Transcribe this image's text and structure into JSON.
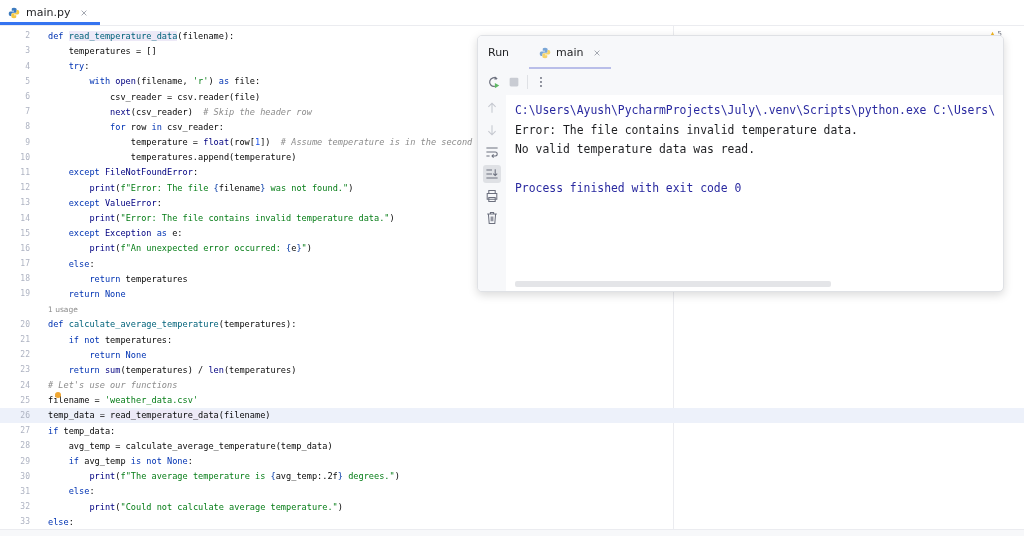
{
  "editor_tabs": [
    {
      "label": "main.py",
      "selected": true
    }
  ],
  "inspection_count": "5",
  "lines": [
    {
      "kind": "code",
      "number": "2",
      "current": false,
      "bulb": false,
      "tokens": [
        {
          "kind": "kw",
          "text": "def "
        },
        {
          "kind": "name_hl",
          "text": "read_temperature_data"
        },
        {
          "kind": "plain",
          "text": "(filename):"
        }
      ],
      "children": [
        {
          "kind": "code",
          "number": "3",
          "current": false,
          "bulb": false,
          "tokens": [
            {
              "kind": "plain",
              "text": "temperatures = []"
            }
          ]
        },
        {
          "kind": "code",
          "number": "4",
          "current": false,
          "bulb": false,
          "tokens": [
            {
              "kind": "kw",
              "text": "try"
            },
            {
              "kind": "plain",
              "text": ":"
            }
          ],
          "children": [
            {
              "kind": "code",
              "number": "5",
              "current": false,
              "bulb": false,
              "tokens": [
                {
                  "kind": "kw",
                  "text": "with "
                },
                {
                  "kind": "builtin",
                  "text": "open"
                },
                {
                  "kind": "plain",
                  "text": "(filename, "
                },
                {
                  "kind": "str",
                  "text": "'r'"
                },
                {
                  "kind": "plain",
                  "text": ") "
                },
                {
                  "kind": "kw",
                  "text": "as"
                },
                {
                  "kind": "plain",
                  "text": " file:"
                }
              ],
              "children": [
                {
                  "kind": "code",
                  "number": "6",
                  "current": false,
                  "bulb": false,
                  "tokens": [
                    {
                      "kind": "plain",
                      "text": "csv_reader = csv.reader(file)"
                    }
                  ]
                },
                {
                  "kind": "code",
                  "number": "7",
                  "current": false,
                  "bulb": false,
                  "tokens": [
                    {
                      "kind": "builtin",
                      "text": "next"
                    },
                    {
                      "kind": "plain",
                      "text": "(csv_reader)  "
                    },
                    {
                      "kind": "cmt",
                      "text": "# Skip the header row"
                    }
                  ]
                },
                {
                  "kind": "code",
                  "number": "8",
                  "current": false,
                  "bulb": false,
                  "tokens": [
                    {
                      "kind": "kw",
                      "text": "for"
                    },
                    {
                      "kind": "plain",
                      "text": " row "
                    },
                    {
                      "kind": "kw",
                      "text": "in"
                    },
                    {
                      "kind": "plain",
                      "text": " csv_reader:"
                    }
                  ],
                  "children": [
                    {
                      "kind": "code",
                      "number": "9",
                      "current": false,
                      "bulb": false,
                      "tokens": [
                        {
                          "kind": "plain",
                          "text": "temperature = "
                        },
                        {
                          "kind": "builtin",
                          "text": "float"
                        },
                        {
                          "kind": "plain",
                          "text": "(row["
                        },
                        {
                          "kind": "num",
                          "text": "1"
                        },
                        {
                          "kind": "plain",
                          "text": "])  "
                        },
                        {
                          "kind": "cmt",
                          "text": "# Assume temperature is in the second"
                        }
                      ]
                    },
                    {
                      "kind": "code",
                      "number": "10",
                      "current": false,
                      "bulb": false,
                      "tokens": [
                        {
                          "kind": "plain",
                          "text": "temperatures.append(temperature)"
                        }
                      ]
                    }
                  ]
                }
              ]
            }
          ]
        },
        {
          "kind": "code",
          "number": "11",
          "current": false,
          "bulb": false,
          "tokens": [
            {
              "kind": "kw",
              "text": "except "
            },
            {
              "kind": "builtin",
              "text": "FileNotFoundError"
            },
            {
              "kind": "plain",
              "text": ":"
            }
          ],
          "children": [
            {
              "kind": "code",
              "number": "12",
              "current": false,
              "bulb": false,
              "tokens": [
                {
                  "kind": "builtin",
                  "text": "print"
                },
                {
                  "kind": "plain",
                  "text": "("
                },
                {
                  "kind": "str",
                  "text": "f\"Error: The file "
                },
                {
                  "kind": "brace",
                  "text": "{"
                },
                {
                  "kind": "plain",
                  "text": "filename"
                },
                {
                  "kind": "brace",
                  "text": "}"
                },
                {
                  "kind": "str",
                  "text": " was not found.\""
                },
                {
                  "kind": "plain",
                  "text": ")"
                }
              ]
            }
          ]
        },
        {
          "kind": "code",
          "number": "13",
          "current": false,
          "bulb": false,
          "tokens": [
            {
              "kind": "kw",
              "text": "except "
            },
            {
              "kind": "builtin",
              "text": "ValueError"
            },
            {
              "kind": "plain",
              "text": ":"
            }
          ],
          "children": [
            {
              "kind": "code",
              "number": "14",
              "current": false,
              "bulb": false,
              "tokens": [
                {
                  "kind": "builtin",
                  "text": "print"
                },
                {
                  "kind": "plain",
                  "text": "("
                },
                {
                  "kind": "str",
                  "text": "\"Error: The file contains invalid temperature data.\""
                },
                {
                  "kind": "plain",
                  "text": ")"
                }
              ]
            }
          ]
        },
        {
          "kind": "code",
          "number": "15",
          "current": false,
          "bulb": false,
          "tokens": [
            {
              "kind": "kw",
              "text": "except "
            },
            {
              "kind": "builtin",
              "text": "Exception"
            },
            {
              "kind": "kw",
              "text": " as"
            },
            {
              "kind": "plain",
              "text": " e:"
            }
          ],
          "children": [
            {
              "kind": "code",
              "number": "16",
              "current": false,
              "bulb": false,
              "tokens": [
                {
                  "kind": "builtin",
                  "text": "print"
                },
                {
                  "kind": "plain",
                  "text": "("
                },
                {
                  "kind": "str",
                  "text": "f\"An unexpected error occurred: "
                },
                {
                  "kind": "brace",
                  "text": "{"
                },
                {
                  "kind": "plain",
                  "text": "e"
                },
                {
                  "kind": "brace",
                  "text": "}"
                },
                {
                  "kind": "str",
                  "text": "\""
                },
                {
                  "kind": "plain",
                  "text": ")"
                }
              ]
            }
          ]
        },
        {
          "kind": "code",
          "number": "17",
          "current": false,
          "bulb": false,
          "tokens": [
            {
              "kind": "kw",
              "text": "else"
            },
            {
              "kind": "plain",
              "text": ":"
            }
          ],
          "children": [
            {
              "kind": "code",
              "number": "18",
              "current": false,
              "bulb": false,
              "tokens": [
                {
                  "kind": "kw",
                  "text": "return"
                },
                {
                  "kind": "plain",
                  "text": " temperatures"
                }
              ]
            }
          ]
        },
        {
          "kind": "code",
          "number": "19",
          "current": false,
          "bulb": false,
          "tokens": [
            {
              "kind": "kw",
              "text": "return None"
            }
          ]
        }
      ]
    },
    {
      "kind": "hint",
      "text": "1 usage"
    },
    {
      "kind": "code",
      "number": "20",
      "current": false,
      "bulb": false,
      "tokens": [
        {
          "kind": "kw",
          "text": "def "
        },
        {
          "kind": "name",
          "text": "calculate_average_temperature"
        },
        {
          "kind": "plain",
          "text": "(temperatures):"
        }
      ],
      "children": [
        {
          "kind": "code",
          "number": "21",
          "current": false,
          "bulb": false,
          "tokens": [
            {
              "kind": "kw",
              "text": "if not"
            },
            {
              "kind": "plain",
              "text": " temperatures:"
            }
          ],
          "children": [
            {
              "kind": "code",
              "number": "22",
              "current": false,
              "bulb": false,
              "tokens": [
                {
                  "kind": "kw",
                  "text": "return None"
                }
              ]
            }
          ]
        },
        {
          "kind": "code",
          "number": "23",
          "current": false,
          "bulb": false,
          "tokens": [
            {
              "kind": "kw",
              "text": "return "
            },
            {
              "kind": "builtin",
              "text": "sum"
            },
            {
              "kind": "plain",
              "text": "(temperatures) / "
            },
            {
              "kind": "builtin",
              "text": "len"
            },
            {
              "kind": "plain",
              "text": "(temperatures)"
            }
          ]
        }
      ]
    },
    {
      "kind": "code",
      "number": "24",
      "current": false,
      "bulb": false,
      "tokens": [
        {
          "kind": "cmt",
          "text": "# Let's use our functions"
        }
      ]
    },
    {
      "kind": "code",
      "number": "25",
      "current": false,
      "bulb": true,
      "tokens": [
        {
          "kind": "plain",
          "text": "filename = "
        },
        {
          "kind": "str",
          "text": "'weather_data.csv'"
        }
      ]
    },
    {
      "kind": "code",
      "number": "26",
      "current": true,
      "bulb": false,
      "tokens": [
        {
          "kind": "plain",
          "text": "temp_data = "
        },
        {
          "kind": "plain_hl",
          "text": "read_temperature_data"
        },
        {
          "kind": "plain",
          "text": "(filename)"
        }
      ]
    },
    {
      "kind": "code",
      "number": "27",
      "current": false,
      "bulb": false,
      "tokens": [
        {
          "kind": "kw",
          "text": "if"
        },
        {
          "kind": "plain",
          "text": " temp_data:"
        }
      ],
      "children": [
        {
          "kind": "code",
          "number": "28",
          "current": false,
          "bulb": false,
          "tokens": [
            {
              "kind": "plain",
              "text": "avg_temp = calculate_average_temperature(temp_data)"
            }
          ]
        },
        {
          "kind": "code",
          "number": "29",
          "current": false,
          "bulb": false,
          "tokens": [
            {
              "kind": "kw",
              "text": "if"
            },
            {
              "kind": "plain",
              "text": " avg_temp "
            },
            {
              "kind": "kw",
              "text": "is not None"
            },
            {
              "kind": "plain",
              "text": ":"
            }
          ],
          "children": [
            {
              "kind": "code",
              "number": "30",
              "current": false,
              "bulb": false,
              "tokens": [
                {
                  "kind": "builtin",
                  "text": "print"
                },
                {
                  "kind": "plain",
                  "text": "("
                },
                {
                  "kind": "str",
                  "text": "f\"The average temperature is "
                },
                {
                  "kind": "brace",
                  "text": "{"
                },
                {
                  "kind": "plain",
                  "text": "avg_temp:.2f"
                },
                {
                  "kind": "brace",
                  "text": "}"
                },
                {
                  "kind": "str",
                  "text": " degrees.\""
                },
                {
                  "kind": "plain",
                  "text": ")"
                }
              ]
            }
          ]
        },
        {
          "kind": "code",
          "number": "31",
          "current": false,
          "bulb": false,
          "tokens": [
            {
              "kind": "kw",
              "text": "else"
            },
            {
              "kind": "plain",
              "text": ":"
            }
          ],
          "children": [
            {
              "kind": "code",
              "number": "32",
              "current": false,
              "bulb": false,
              "tokens": [
                {
                  "kind": "builtin",
                  "text": "print"
                },
                {
                  "kind": "plain",
                  "text": "("
                },
                {
                  "kind": "str",
                  "text": "\"Could not calculate average temperature.\""
                },
                {
                  "kind": "plain",
                  "text": ")"
                }
              ]
            }
          ]
        }
      ]
    },
    {
      "kind": "code",
      "number": "33",
      "current": false,
      "bulb": false,
      "tokens": [
        {
          "kind": "kw",
          "text": "else"
        },
        {
          "kind": "plain",
          "text": ":"
        }
      ]
    }
  ],
  "run_window": {
    "title": "Run",
    "tabs": [
      {
        "label": "main",
        "selected": true
      }
    ],
    "side_tools": [
      {
        "kind": "up",
        "disabled": true,
        "on": false
      },
      {
        "kind": "down",
        "disabled": true,
        "on": false
      },
      {
        "kind": "wrap",
        "disabled": false,
        "on": false
      },
      {
        "kind": "scroll_end",
        "disabled": false,
        "on": true
      },
      {
        "kind": "print",
        "disabled": false,
        "on": false
      },
      {
        "kind": "trash",
        "disabled": false,
        "on": false
      }
    ],
    "console": [
      {
        "kind": "command",
        "text": "C:\\Users\\Ayush\\PycharmProjects\\July\\.venv\\Scripts\\python.exe C:\\Users\\"
      },
      {
        "kind": "stdout",
        "text": "Error: The file contains invalid temperature data."
      },
      {
        "kind": "stdout",
        "text": "No valid temperature data was read."
      },
      {
        "kind": "exit",
        "text": "Process finished with exit code 0"
      }
    ]
  }
}
